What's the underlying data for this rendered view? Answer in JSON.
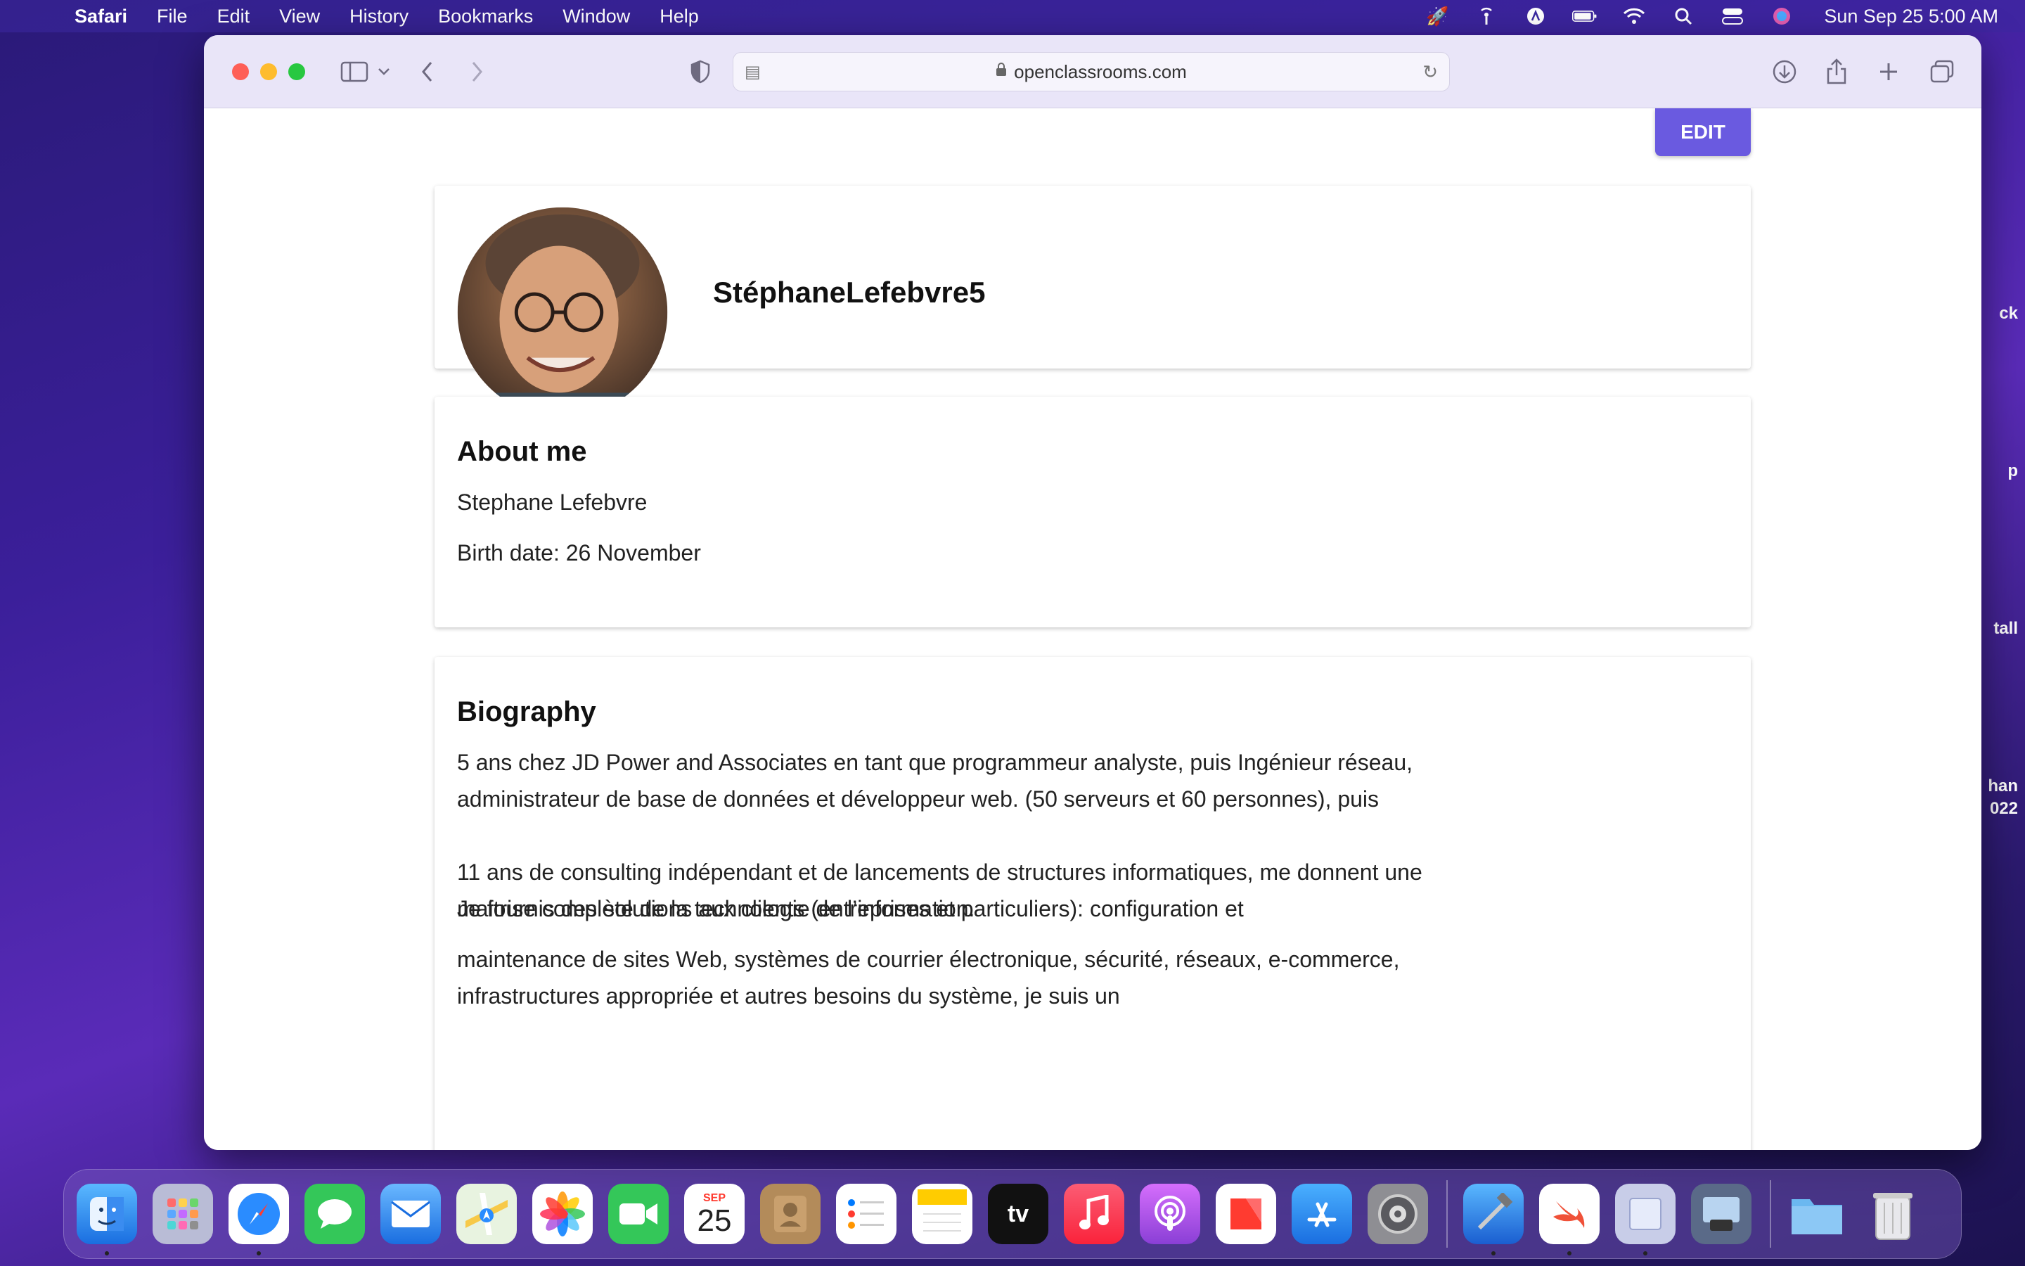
{
  "menubar": {
    "app_name": "Safari",
    "items": [
      "File",
      "Edit",
      "View",
      "History",
      "Bookmarks",
      "Window",
      "Help"
    ],
    "clock": "Sun Sep 25  5:00 AM"
  },
  "desktop_peek": [
    "ck",
    "p",
    "tall",
    "han",
    "022"
  ],
  "browser": {
    "url": "openclassrooms.com"
  },
  "page": {
    "edit_label": "EDIT",
    "username": "StéphaneLefebvre5",
    "about": {
      "heading": "About me",
      "name": "Stephane Lefebvre",
      "birth": "Birth date: 26 November"
    },
    "bio": {
      "heading": "Biography",
      "p1": "5 ans chez JD Power and Associates en tant que programmeur analyste, puis Ingénieur réseau, administrateur de base de données et développeur web. (50 serveurs et 60 personnes), puis",
      "p2": "11 ans de consulting indépendant et de lancements de structures informatiques, me donnent une maitrise complète de la technologie de l’information.",
      "p3": "Je fournis des solutions aux clients (entreprises et particuliers): configuration et",
      "p4": "maintenance de sites Web, systèmes de courrier électronique, sécurité, réseaux, e-commerce, infrastructures appropriée et autres besoins du système, je suis un"
    }
  },
  "dock": {
    "calendar_month": "SEP",
    "calendar_day": "25",
    "tv_label": "tv"
  }
}
